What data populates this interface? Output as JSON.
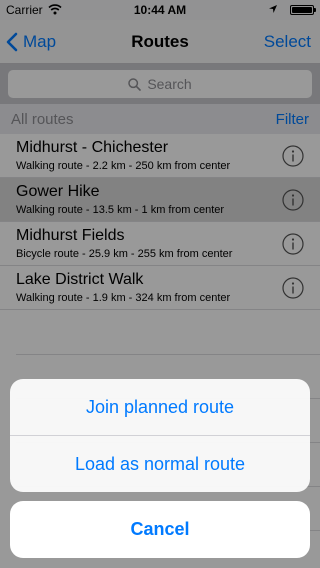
{
  "status_bar": {
    "carrier": "Carrier",
    "time": "10:44 AM",
    "battery_level": 1.0
  },
  "nav": {
    "back_label": "Map",
    "title": "Routes",
    "right_label": "Select"
  },
  "search": {
    "placeholder": "Search"
  },
  "section": {
    "title": "All routes",
    "filter_label": "Filter"
  },
  "routes": [
    {
      "title": "Midhurst - Chichester",
      "subtitle": "Walking route - 2.2 km - 250 km from center",
      "selected": false
    },
    {
      "title": "Gower Hike",
      "subtitle": "Walking route - 13.5 km - 1 km from center",
      "selected": true
    },
    {
      "title": "Midhurst Fields",
      "subtitle": "Bicycle route - 25.9 km - 255 km from center",
      "selected": false
    },
    {
      "title": "Lake District Walk",
      "subtitle": "Walking route - 1.9 km - 324 km from center",
      "selected": false
    }
  ],
  "action_sheet": {
    "actions": [
      "Join planned route",
      "Load as normal route"
    ],
    "cancel_label": "Cancel"
  },
  "colors": {
    "accent": "#007aff",
    "selected_row": "#d9d9d9"
  },
  "icons": {
    "back": "chevron-left-icon",
    "search": "search-icon",
    "info": "info-circle-icon",
    "wifi": "wifi-icon",
    "location": "location-arrow-icon",
    "battery": "battery-icon"
  }
}
